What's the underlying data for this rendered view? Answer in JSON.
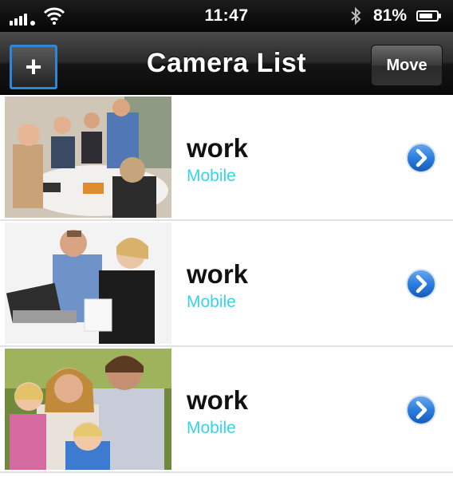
{
  "status_bar": {
    "time": "11:47",
    "battery_percent": "81%",
    "battery_level": 0.81,
    "signal_icon": "signal-bars-icon",
    "wifi_icon": "wifi-icon",
    "bluetooth_icon": "bluetooth-icon"
  },
  "nav": {
    "title": "Camera List",
    "add_label": "+",
    "move_label": "Move"
  },
  "colors": {
    "accent_blue": "#2f86d6",
    "subtitle_cyan": "#39d3e6",
    "disclosure_blue": "#1f6fd0"
  },
  "cameras": [
    {
      "name": "work",
      "type": "Mobile",
      "thumbnail": "office-meeting-photo"
    },
    {
      "name": "work",
      "type": "Mobile",
      "thumbnail": "business-discussion-photo"
    },
    {
      "name": "work",
      "type": "Mobile",
      "thumbnail": "family-portrait-photo"
    }
  ]
}
